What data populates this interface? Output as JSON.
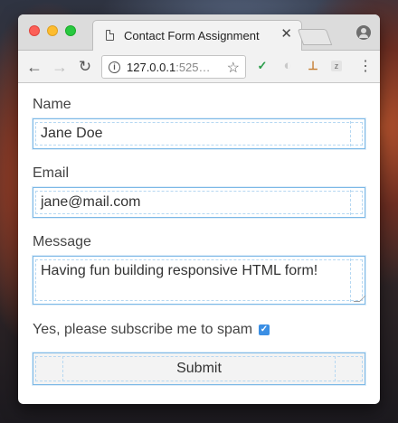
{
  "browser": {
    "tab_title": "Contact Form Assignment",
    "tab_close": "✕",
    "url_host": "127.0.0.1",
    "url_port": ":525…",
    "back_glyph": "←",
    "forward_glyph": "→",
    "reload_glyph": "↻",
    "star_glyph": "☆",
    "info_glyph": "i",
    "menu_glyph": "⋮",
    "extensions": [
      {
        "icon": "vue-devtools-icon",
        "glyph": "✓"
      },
      {
        "icon": "extension-drop-icon",
        "glyph": "◐"
      },
      {
        "icon": "extension-tag-icon",
        "glyph": "⊥"
      },
      {
        "icon": "extension-z-icon",
        "glyph": "z"
      }
    ]
  },
  "form": {
    "name": {
      "label": "Name",
      "value": "Jane Doe"
    },
    "email": {
      "label": "Email",
      "value": "jane@mail.com"
    },
    "message": {
      "label": "Message",
      "value": "Having fun building responsive HTML form!"
    },
    "subscribe": {
      "label": "Yes, please subscribe me to spam",
      "checked": true,
      "check_glyph": "✓"
    },
    "submit_label": "Submit"
  },
  "colors": {
    "focus_outline": "#7cb8e6",
    "checkbox": "#3b8fe4"
  }
}
